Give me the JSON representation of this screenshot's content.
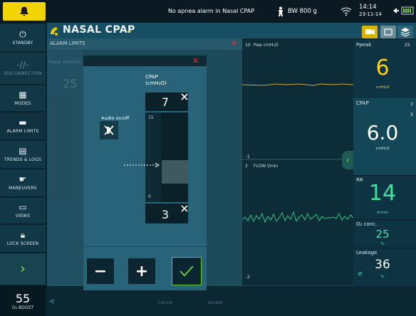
{
  "topbar": {
    "status_message": "No apnea alarm in Nasal CPAP",
    "body_weight": "BW 800 g",
    "time": "14:14",
    "date": "23-11-14"
  },
  "sidebar": {
    "items": [
      {
        "key": "standby",
        "label": "STANDBY",
        "icon": "power-icon"
      },
      {
        "key": "disconnection",
        "label": "DISCONNECTION",
        "icon": "disconnection-icon"
      },
      {
        "key": "modes",
        "label": "MODES",
        "icon": "grid-icon"
      },
      {
        "key": "alarm_limits",
        "label": "ALARM LIMITS",
        "icon": "alarm-limits-icon"
      },
      {
        "key": "trends_logs",
        "label": "TRENDS & LOGS",
        "icon": "trends-icon"
      },
      {
        "key": "maneuvers",
        "label": "MANEUVERS",
        "icon": "maneuvers-icon"
      },
      {
        "key": "views",
        "label": "VIEWS",
        "icon": "views-icon"
      },
      {
        "key": "lock_screen",
        "label": "LOCK SCREEN",
        "icon": "lock-icon"
      }
    ],
    "o2_boost_value": "55",
    "o2_boost_label": "O₂ BOOST"
  },
  "mode": {
    "title": "NASAL CPAP"
  },
  "waveforms": {
    "paw_label": "Paw cmH₂O",
    "paw_scale_top": "10",
    "paw_scale_bottom": "-1",
    "flow_label": "FLOW l/min",
    "flow_scale_top": "2",
    "flow_scale_bottom": "-2"
  },
  "parameters": {
    "ppeak": {
      "label": "Ppeak",
      "value": "6",
      "unit": "cmH₂O",
      "limit": "25"
    },
    "cpap": {
      "label": "CPAP",
      "value": "6.0",
      "unit": "cmH₂O",
      "limit_high": "7",
      "limit_low": "3"
    },
    "rr": {
      "label": "RR",
      "value": "14",
      "unit": "b/min"
    },
    "o2": {
      "label": "O₂ conc.",
      "value": "25",
      "unit": "%"
    },
    "leakage": {
      "label": "Leakage",
      "value": "36",
      "unit": "%"
    }
  },
  "alarm_limits": {
    "title": "ALARM LIMITS",
    "ppeak_label": "Ppeak (cmH₂O)",
    "ppeak_value": "25",
    "cancel_label": "Cancel",
    "accept_label": "Accept"
  },
  "dialog": {
    "cpap_label": "CPAP (cmH₂O)",
    "audio_label": "Audio on/off",
    "upper_limit": "7",
    "lower_limit": "3",
    "scale_max": "15",
    "scale_min": "0",
    "minus_label": "−",
    "plus_label": "+"
  },
  "colors": {
    "alarm_yellow": "#f2d400",
    "accept_green": "#67c63a",
    "close_red": "#ff2a2a",
    "value_yellow": "#ffd400",
    "value_green": "#3ee0a0"
  }
}
